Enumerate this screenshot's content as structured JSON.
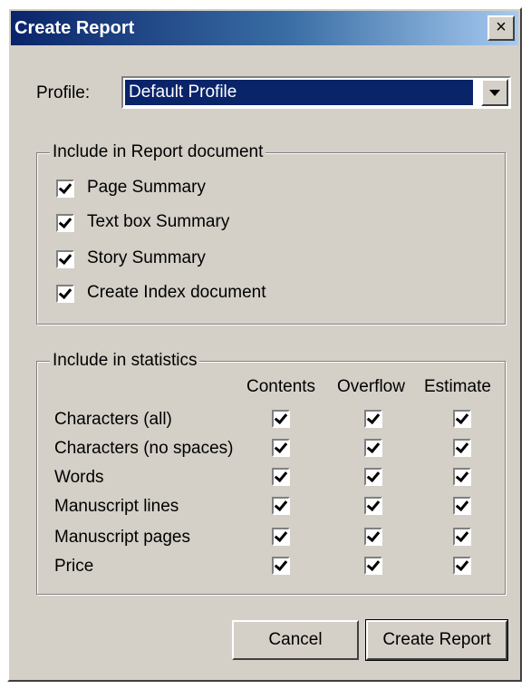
{
  "window": {
    "title": "Create Report",
    "close_glyph": "×"
  },
  "profile": {
    "label": "Profile:",
    "value": "Default Profile"
  },
  "report_group": {
    "legend": "Include in Report document",
    "items": [
      {
        "label": "Page Summary",
        "checked": true
      },
      {
        "label": "Text box Summary",
        "checked": true
      },
      {
        "label": "Story Summary",
        "checked": true
      },
      {
        "label": "Create Index document",
        "checked": true
      }
    ]
  },
  "stats_group": {
    "legend": "Include in statistics",
    "columns": [
      "Contents",
      "Overflow",
      "Estimate"
    ],
    "rows": [
      {
        "label": "Characters (all)",
        "checks": [
          true,
          true,
          true
        ]
      },
      {
        "label": "Characters (no spaces)",
        "checks": [
          true,
          true,
          true
        ]
      },
      {
        "label": "Words",
        "checks": [
          true,
          true,
          true
        ]
      },
      {
        "label": "Manuscript lines",
        "checks": [
          true,
          true,
          true
        ]
      },
      {
        "label": "Manuscript pages",
        "checks": [
          true,
          true,
          true
        ]
      },
      {
        "label": "Price",
        "checks": [
          true,
          true,
          true
        ]
      }
    ]
  },
  "buttons": {
    "cancel": "Cancel",
    "create": "Create Report"
  },
  "icons": {
    "close": "close-icon",
    "dropdown": "chevron-down-icon",
    "check": "checkmark-icon"
  },
  "colors": {
    "titlebar_start": "#0a246a",
    "titlebar_end": "#a6caf0",
    "face": "#d4d0c8",
    "selection": "#0a246a"
  }
}
